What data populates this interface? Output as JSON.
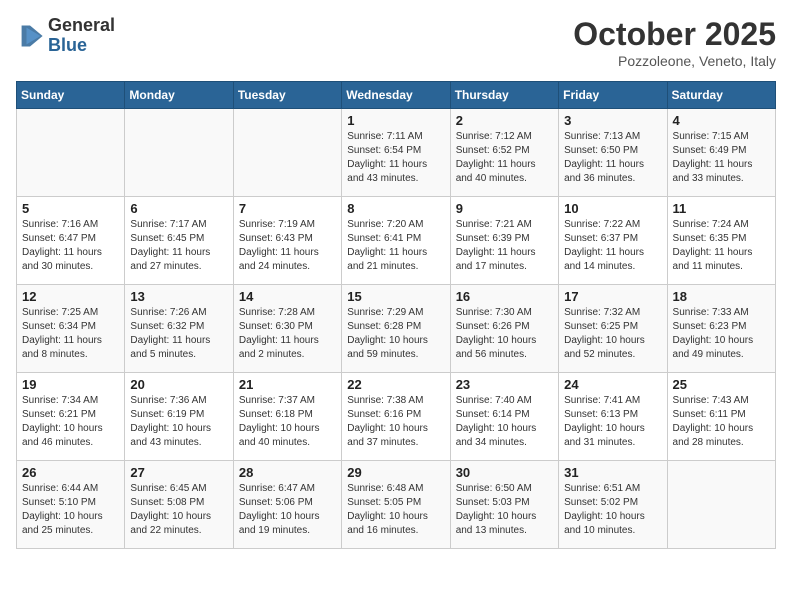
{
  "logo": {
    "general": "General",
    "blue": "Blue"
  },
  "title": "October 2025",
  "subtitle": "Pozzoleone, Veneto, Italy",
  "days_of_week": [
    "Sunday",
    "Monday",
    "Tuesday",
    "Wednesday",
    "Thursday",
    "Friday",
    "Saturday"
  ],
  "weeks": [
    [
      {
        "day": "",
        "info": ""
      },
      {
        "day": "",
        "info": ""
      },
      {
        "day": "",
        "info": ""
      },
      {
        "day": "1",
        "info": "Sunrise: 7:11 AM\nSunset: 6:54 PM\nDaylight: 11 hours and 43 minutes."
      },
      {
        "day": "2",
        "info": "Sunrise: 7:12 AM\nSunset: 6:52 PM\nDaylight: 11 hours and 40 minutes."
      },
      {
        "day": "3",
        "info": "Sunrise: 7:13 AM\nSunset: 6:50 PM\nDaylight: 11 hours and 36 minutes."
      },
      {
        "day": "4",
        "info": "Sunrise: 7:15 AM\nSunset: 6:49 PM\nDaylight: 11 hours and 33 minutes."
      }
    ],
    [
      {
        "day": "5",
        "info": "Sunrise: 7:16 AM\nSunset: 6:47 PM\nDaylight: 11 hours and 30 minutes."
      },
      {
        "day": "6",
        "info": "Sunrise: 7:17 AM\nSunset: 6:45 PM\nDaylight: 11 hours and 27 minutes."
      },
      {
        "day": "7",
        "info": "Sunrise: 7:19 AM\nSunset: 6:43 PM\nDaylight: 11 hours and 24 minutes."
      },
      {
        "day": "8",
        "info": "Sunrise: 7:20 AM\nSunset: 6:41 PM\nDaylight: 11 hours and 21 minutes."
      },
      {
        "day": "9",
        "info": "Sunrise: 7:21 AM\nSunset: 6:39 PM\nDaylight: 11 hours and 17 minutes."
      },
      {
        "day": "10",
        "info": "Sunrise: 7:22 AM\nSunset: 6:37 PM\nDaylight: 11 hours and 14 minutes."
      },
      {
        "day": "11",
        "info": "Sunrise: 7:24 AM\nSunset: 6:35 PM\nDaylight: 11 hours and 11 minutes."
      }
    ],
    [
      {
        "day": "12",
        "info": "Sunrise: 7:25 AM\nSunset: 6:34 PM\nDaylight: 11 hours and 8 minutes."
      },
      {
        "day": "13",
        "info": "Sunrise: 7:26 AM\nSunset: 6:32 PM\nDaylight: 11 hours and 5 minutes."
      },
      {
        "day": "14",
        "info": "Sunrise: 7:28 AM\nSunset: 6:30 PM\nDaylight: 11 hours and 2 minutes."
      },
      {
        "day": "15",
        "info": "Sunrise: 7:29 AM\nSunset: 6:28 PM\nDaylight: 10 hours and 59 minutes."
      },
      {
        "day": "16",
        "info": "Sunrise: 7:30 AM\nSunset: 6:26 PM\nDaylight: 10 hours and 56 minutes."
      },
      {
        "day": "17",
        "info": "Sunrise: 7:32 AM\nSunset: 6:25 PM\nDaylight: 10 hours and 52 minutes."
      },
      {
        "day": "18",
        "info": "Sunrise: 7:33 AM\nSunset: 6:23 PM\nDaylight: 10 hours and 49 minutes."
      }
    ],
    [
      {
        "day": "19",
        "info": "Sunrise: 7:34 AM\nSunset: 6:21 PM\nDaylight: 10 hours and 46 minutes."
      },
      {
        "day": "20",
        "info": "Sunrise: 7:36 AM\nSunset: 6:19 PM\nDaylight: 10 hours and 43 minutes."
      },
      {
        "day": "21",
        "info": "Sunrise: 7:37 AM\nSunset: 6:18 PM\nDaylight: 10 hours and 40 minutes."
      },
      {
        "day": "22",
        "info": "Sunrise: 7:38 AM\nSunset: 6:16 PM\nDaylight: 10 hours and 37 minutes."
      },
      {
        "day": "23",
        "info": "Sunrise: 7:40 AM\nSunset: 6:14 PM\nDaylight: 10 hours and 34 minutes."
      },
      {
        "day": "24",
        "info": "Sunrise: 7:41 AM\nSunset: 6:13 PM\nDaylight: 10 hours and 31 minutes."
      },
      {
        "day": "25",
        "info": "Sunrise: 7:43 AM\nSunset: 6:11 PM\nDaylight: 10 hours and 28 minutes."
      }
    ],
    [
      {
        "day": "26",
        "info": "Sunrise: 6:44 AM\nSunset: 5:10 PM\nDaylight: 10 hours and 25 minutes."
      },
      {
        "day": "27",
        "info": "Sunrise: 6:45 AM\nSunset: 5:08 PM\nDaylight: 10 hours and 22 minutes."
      },
      {
        "day": "28",
        "info": "Sunrise: 6:47 AM\nSunset: 5:06 PM\nDaylight: 10 hours and 19 minutes."
      },
      {
        "day": "29",
        "info": "Sunrise: 6:48 AM\nSunset: 5:05 PM\nDaylight: 10 hours and 16 minutes."
      },
      {
        "day": "30",
        "info": "Sunrise: 6:50 AM\nSunset: 5:03 PM\nDaylight: 10 hours and 13 minutes."
      },
      {
        "day": "31",
        "info": "Sunrise: 6:51 AM\nSunset: 5:02 PM\nDaylight: 10 hours and 10 minutes."
      },
      {
        "day": "",
        "info": ""
      }
    ]
  ]
}
